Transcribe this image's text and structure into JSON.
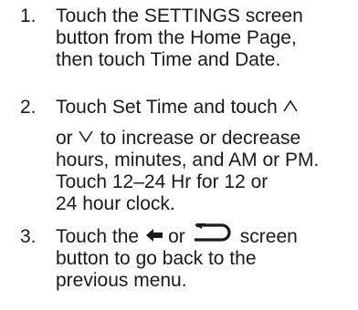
{
  "steps": [
    {
      "number": "1.",
      "lines": [
        "Touch the SETTINGS screen",
        "button from the Home Page,",
        "then touch Time and Date."
      ]
    },
    {
      "number": "2.",
      "line1_text": "Touch Set Time and touch",
      "line2_or": "or",
      "line2_text": "to increase or decrease",
      "rest_lines": [
        "hours, minutes, and AM or PM.",
        "Touch 12–24 Hr for 12 or",
        "24 hour clock."
      ],
      "icons": [
        "chevron-up-icon",
        "chevron-down-icon"
      ]
    },
    {
      "number": "3.",
      "line1_pre": "Touch the",
      "line1_or": "or",
      "line1_post": "screen",
      "rest_lines": [
        "button to go back to the",
        "previous menu."
      ],
      "icons": [
        "back-arrow-icon",
        "return-arrow-icon"
      ]
    }
  ]
}
